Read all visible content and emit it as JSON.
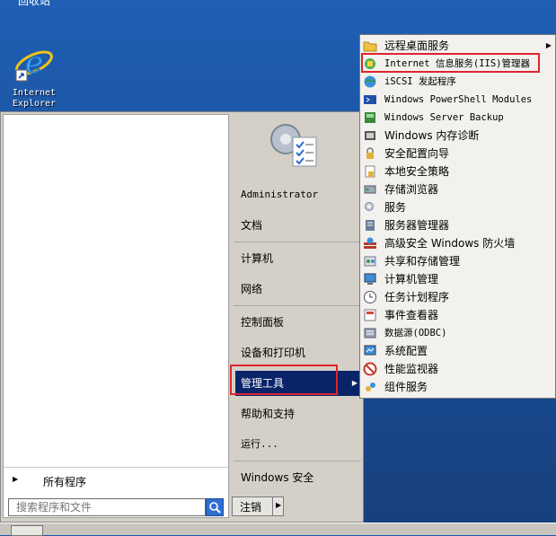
{
  "desktop": {
    "top_label": "回收站",
    "ie_label_line1": "Internet",
    "ie_label_line2": "Explorer"
  },
  "start_menu": {
    "all_programs": "所有程序",
    "search_placeholder": "搜索程序和文件",
    "right_items": [
      {
        "label": "Administrator"
      },
      {
        "label": "文档"
      },
      {
        "label": "计算机"
      },
      {
        "label": "网络"
      },
      {
        "label": "控制面板"
      },
      {
        "label": "设备和打印机"
      },
      {
        "label": "管理工具"
      },
      {
        "label": "帮助和支持"
      },
      {
        "label": "运行..."
      },
      {
        "label": "Windows 安全"
      }
    ],
    "logout_label": "注销"
  },
  "admin_tools": {
    "items": [
      {
        "label": "远程桌面服务",
        "icon": "folder-icon"
      },
      {
        "label": "Internet 信息服务(IIS)管理器",
        "icon": "iis-icon"
      },
      {
        "label": "iSCSI 发起程序",
        "icon": "globe-icon"
      },
      {
        "label": "Windows PowerShell Modules",
        "icon": "powershell-icon"
      },
      {
        "label": "Windows Server Backup",
        "icon": "backup-icon"
      },
      {
        "label": "Windows 内存诊断",
        "icon": "memory-icon"
      },
      {
        "label": "安全配置向导",
        "icon": "security-wizard-icon"
      },
      {
        "label": "本地安全策略",
        "icon": "policy-icon"
      },
      {
        "label": "存储浏览器",
        "icon": "storage-icon"
      },
      {
        "label": "服务",
        "icon": "services-icon"
      },
      {
        "label": "服务器管理器",
        "icon": "server-manager-icon"
      },
      {
        "label": "高级安全 Windows 防火墙",
        "icon": "firewall-icon"
      },
      {
        "label": "共享和存储管理",
        "icon": "share-icon"
      },
      {
        "label": "计算机管理",
        "icon": "computer-mgmt-icon"
      },
      {
        "label": "任务计划程序",
        "icon": "clock-icon"
      },
      {
        "label": "事件查看器",
        "icon": "event-viewer-icon"
      },
      {
        "label": "数据源(ODBC)",
        "icon": "odbc-icon"
      },
      {
        "label": "系统配置",
        "icon": "sysconfig-icon"
      },
      {
        "label": "性能监视器",
        "icon": "perfmon-icon"
      },
      {
        "label": "组件服务",
        "icon": "component-icon"
      }
    ]
  },
  "colors": {
    "highlight": "#0a246a",
    "annotation_red": "#e0242c",
    "menu_bg": "#d4d0c8"
  }
}
